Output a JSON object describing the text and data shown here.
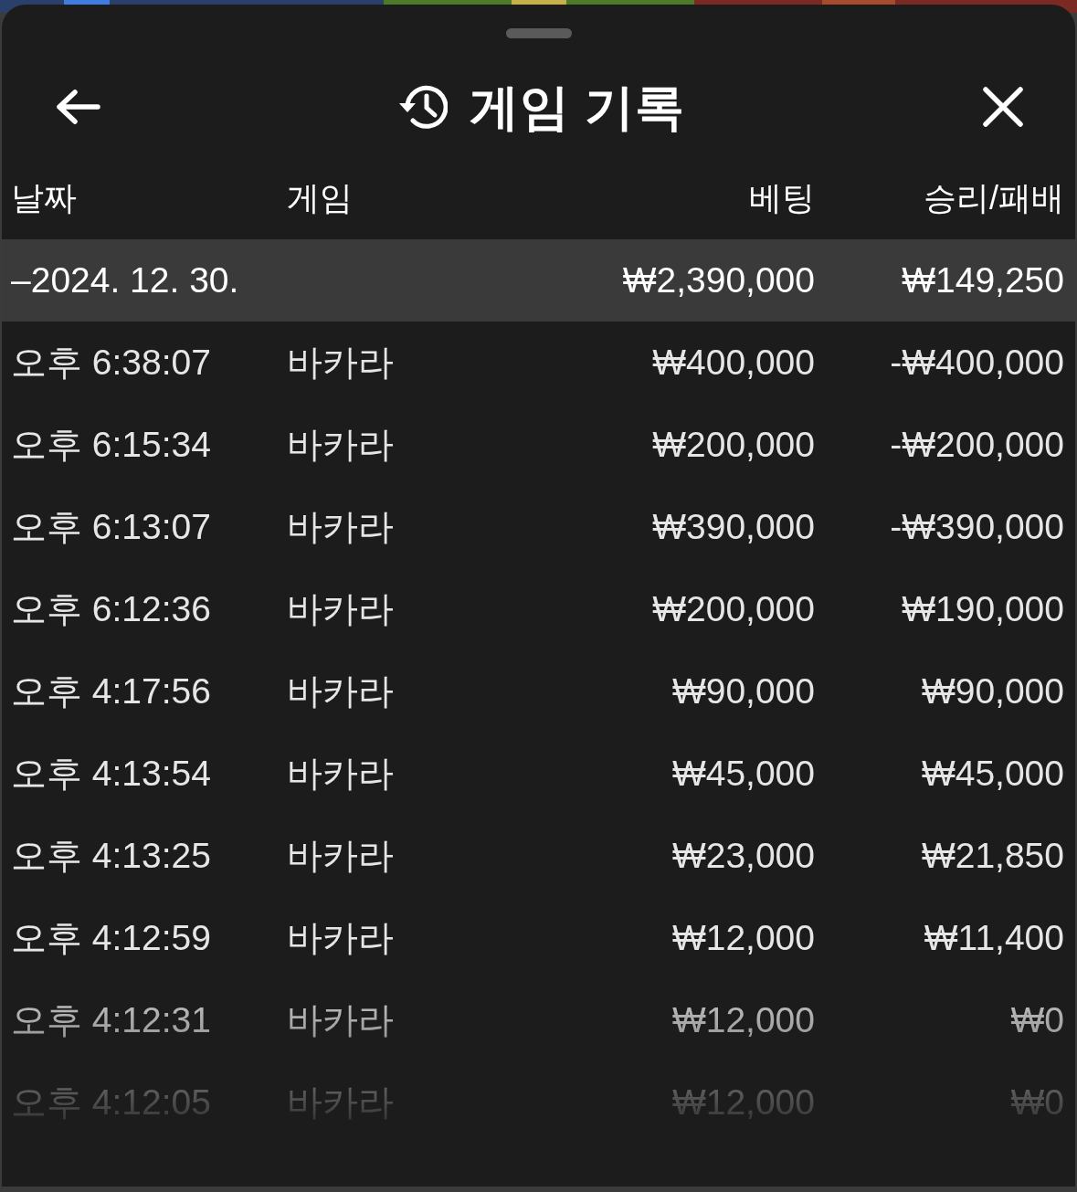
{
  "header": {
    "title": "게임 기록"
  },
  "columns": [
    "날짜",
    "게임",
    "베팅",
    "승리/패배"
  ],
  "group": {
    "date": "–2024. 12. 30.",
    "bet": "₩2,390,000",
    "result": "₩149,250"
  },
  "rows": [
    {
      "time": "오후 6:38:07",
      "game": "바카라",
      "bet": "₩400,000",
      "result": "-₩400,000"
    },
    {
      "time": "오후 6:15:34",
      "game": "바카라",
      "bet": "₩200,000",
      "result": "-₩200,000"
    },
    {
      "time": "오후 6:13:07",
      "game": "바카라",
      "bet": "₩390,000",
      "result": "-₩390,000"
    },
    {
      "time": "오후 6:12:36",
      "game": "바카라",
      "bet": "₩200,000",
      "result": "₩190,000"
    },
    {
      "time": "오후 4:17:56",
      "game": "바카라",
      "bet": "₩90,000",
      "result": "₩90,000"
    },
    {
      "time": "오후 4:13:54",
      "game": "바카라",
      "bet": "₩45,000",
      "result": "₩45,000"
    },
    {
      "time": "오후 4:13:25",
      "game": "바카라",
      "bet": "₩23,000",
      "result": "₩21,850"
    },
    {
      "time": "오후 4:12:59",
      "game": "바카라",
      "bet": "₩12,000",
      "result": "₩11,400"
    },
    {
      "time": "오후 4:12:31",
      "game": "바카라",
      "bet": "₩12,000",
      "result": "₩0"
    },
    {
      "time": "오후 4:12:05",
      "game": "바카라",
      "bet": "₩12,000",
      "result": "₩0"
    }
  ]
}
